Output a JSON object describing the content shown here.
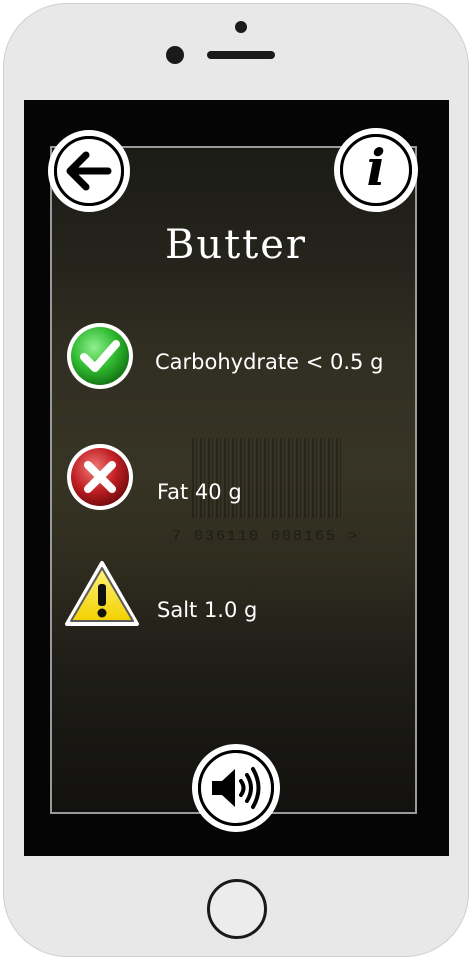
{
  "product": {
    "name": "Butter"
  },
  "nutrients": [
    {
      "label": "Carbohydrate < 0.5 g",
      "status": "good",
      "icon": "check-icon",
      "color": "#2fb82f"
    },
    {
      "label": "Fat 40 g",
      "status": "bad",
      "icon": "cross-icon",
      "color": "#c01f23"
    },
    {
      "label": "Salt 1.0 g",
      "status": "warning",
      "icon": "warning-icon",
      "color": "#f2d100"
    }
  ],
  "background": {
    "barcode_number": "7 036110 008165 >"
  },
  "icons": {
    "back": "back-arrow-icon",
    "info": "info-icon",
    "speaker": "speaker-icon"
  }
}
